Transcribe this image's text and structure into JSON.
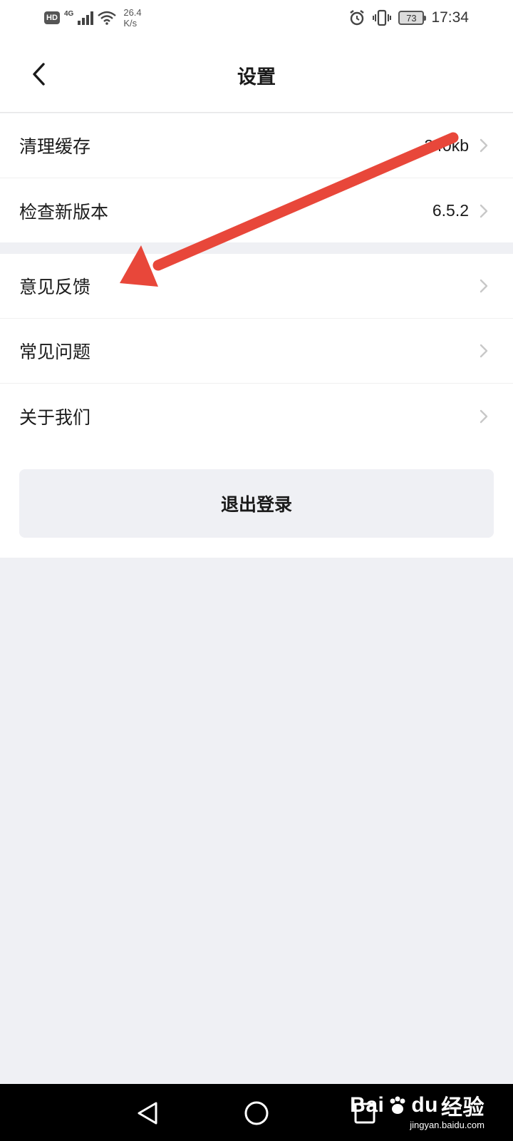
{
  "status_bar": {
    "hd": "HD",
    "network": "4G",
    "speed_value": "26.4",
    "speed_unit": "K/s",
    "battery": "73",
    "time": "17:34"
  },
  "header": {
    "title": "设置"
  },
  "settings": {
    "group1": [
      {
        "label": "清理缓存",
        "value": "240kb"
      },
      {
        "label": "检查新版本",
        "value": "6.5.2"
      }
    ],
    "group2": [
      {
        "label": "意见反馈"
      },
      {
        "label": "常见问题"
      },
      {
        "label": "关于我们"
      }
    ]
  },
  "logout": {
    "label": "退出登录"
  },
  "watermark": {
    "logo_bai": "Bai",
    "logo_du": "du",
    "logo_cn": "经验",
    "site": "jingyan.baidu.com"
  },
  "colors": {
    "background": "#eff0f4",
    "annotation_arrow": "#e8473a",
    "chevron": "#c8c8c8"
  },
  "icons": {
    "back": "chevron-left-icon",
    "row_chevron": "chevron-right-icon",
    "nav_back": "triangle-back-icon",
    "nav_home": "circle-home-icon",
    "nav_recent": "square-recent-icon"
  }
}
